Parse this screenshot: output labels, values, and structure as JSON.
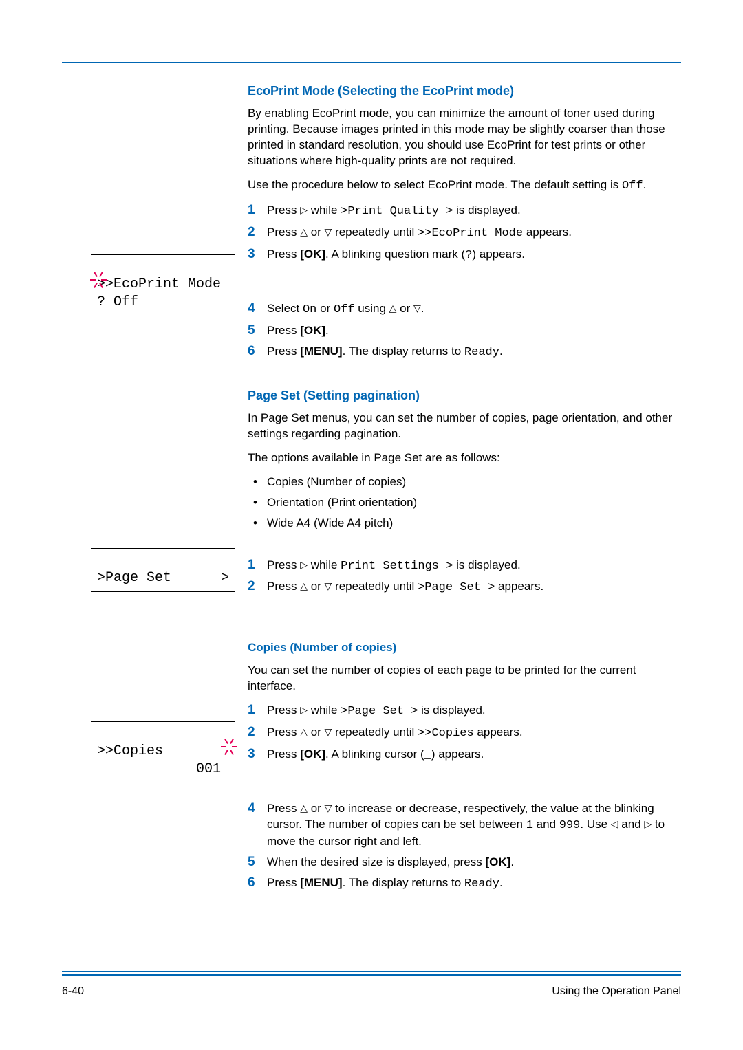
{
  "section1": {
    "heading": "EcoPrint Mode (Selecting the EcoPrint mode)",
    "para1": "By enabling EcoPrint mode, you can minimize the amount of toner used during printing. Because images printed in this mode may be slightly coarser than those printed in standard resolution, you should use EcoPrint for test prints or other situations where high-quality prints are not required.",
    "para2_a": "Use the procedure below to select EcoPrint mode. The default setting is ",
    "para2_b": "Off",
    "para2_c": ".",
    "steps1": {
      "s1_a": "Press ",
      "s1_b": " while ",
      "s1_c": ">Print Quality >",
      "s1_d": " is displayed.",
      "s2_a": "Press ",
      "s2_b": " or ",
      "s2_c": " repeatedly until ",
      "s2_d": ">>EcoPrint Mode",
      "s2_e": " appears.",
      "s3_a": "Press ",
      "s3_b": "[OK]",
      "s3_c": ". A blinking question mark (",
      "s3_d": "?",
      "s3_e": ") appears."
    },
    "lcd_line1": ">>EcoPrint Mode",
    "lcd_line2": "? Off",
    "steps2": {
      "s4_a": "Select ",
      "s4_b": "On",
      "s4_c": " or ",
      "s4_d": "Off",
      "s4_e": " using ",
      "s4_f": " or ",
      "s4_g": ".",
      "s5_a": "Press ",
      "s5_b": "[OK]",
      "s5_c": ".",
      "s6_a": "Press ",
      "s6_b": "[MENU]",
      "s6_c": ". The display returns to ",
      "s6_d": "Ready",
      "s6_e": "."
    }
  },
  "section2": {
    "heading": "Page Set (Setting pagination)",
    "para1": "In Page Set menus, you can set the number of copies, page orientation, and other settings regarding pagination.",
    "para2": "The options available in Page Set are as follows:",
    "bullets": {
      "b1": "Copies (Number of copies)",
      "b2": "Orientation (Print orientation)",
      "b3": "Wide A4 (Wide A4 pitch)"
    },
    "steps": {
      "s1_a": "Press ",
      "s1_b": " while ",
      "s1_c": "Print Settings >",
      "s1_d": " is displayed.",
      "s2_a": "Press ",
      "s2_b": " or ",
      "s2_c": " repeatedly until ",
      "s2_d": ">Page Set >",
      "s2_e": " appears."
    },
    "lcd_line1": ">Page Set      >"
  },
  "section3": {
    "heading": "Copies (Number of copies)",
    "para1": "You can set the number of copies of each page to be printed for the current interface.",
    "steps1": {
      "s1_a": "Press ",
      "s1_b": " while ",
      "s1_c": ">Page Set >",
      "s1_d": " is displayed.",
      "s2_a": "Press ",
      "s2_b": " or ",
      "s2_c": " repeatedly until ",
      "s2_d": ">>Copies",
      "s2_e": " appears.",
      "s3_a": "Press ",
      "s3_b": "[OK]",
      "s3_c": ". A blinking cursor (",
      "s3_d": "_",
      "s3_e": ") appears."
    },
    "lcd_line1": ">>Copies",
    "lcd_line2": "            001",
    "steps2": {
      "s4_a": "Press ",
      "s4_b": " or ",
      "s4_c": " to increase or decrease, respectively, the value at the blinking cursor. The number of copies can be set between ",
      "s4_d": "1",
      "s4_e": " and ",
      "s4_f": "999",
      "s4_g": ". Use ",
      "s4_h": " and ",
      "s4_i": " to move the cursor right and left.",
      "s5_a": "When the desired size is displayed, press ",
      "s5_b": "[OK]",
      "s5_c": ".",
      "s6_a": "Press ",
      "s6_b": "[MENU]",
      "s6_c": ". The display returns to ",
      "s6_d": "Ready",
      "s6_e": "."
    }
  },
  "footer": {
    "left": "6-40",
    "right": "Using the Operation Panel"
  },
  "icons": {
    "tri_right": "▷",
    "tri_up": "△",
    "tri_down": "▽",
    "tri_left": "◁"
  }
}
